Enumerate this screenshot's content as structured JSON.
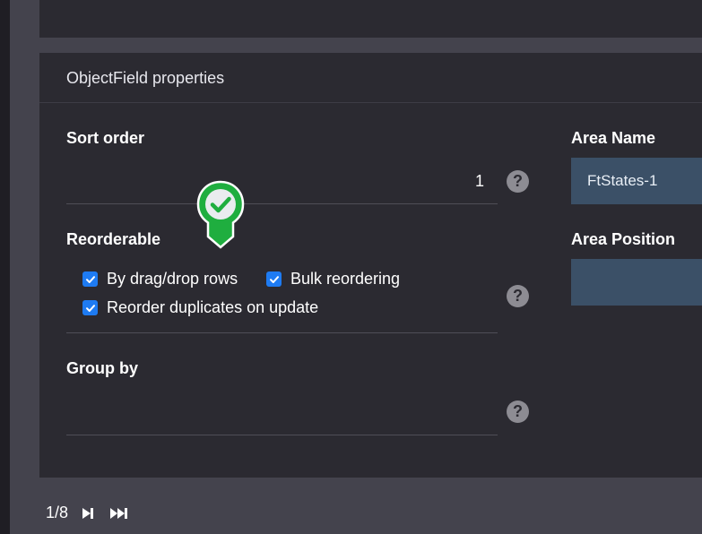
{
  "panel": {
    "title": "ObjectField properties"
  },
  "sort_order": {
    "label": "Sort order",
    "value": "1",
    "help": "?"
  },
  "reorderable": {
    "label": "Reorderable",
    "help": "?",
    "options": [
      {
        "label": "By drag/drop rows",
        "checked": true
      },
      {
        "label": "Bulk reordering",
        "checked": true
      },
      {
        "label": "Reorder duplicates on update",
        "checked": true
      }
    ]
  },
  "group_by": {
    "label": "Group by",
    "value": "",
    "help": "?"
  },
  "area_name": {
    "label": "Area Name",
    "value": "FtStates-1"
  },
  "area_position": {
    "label": "Area Position",
    "value": ""
  },
  "pager": {
    "current": "1/8"
  },
  "colors": {
    "background": "#44434d",
    "panel": "#2b2a31",
    "accent": "#1e7bf2",
    "input": "#3b5067",
    "marker": "#1fae3f"
  },
  "icons": {
    "help": "help-circle-icon",
    "marker": "check-pin-icon",
    "next": "step-forward-icon",
    "last": "fast-forward-icon",
    "checkbox": "checkmark-icon"
  }
}
